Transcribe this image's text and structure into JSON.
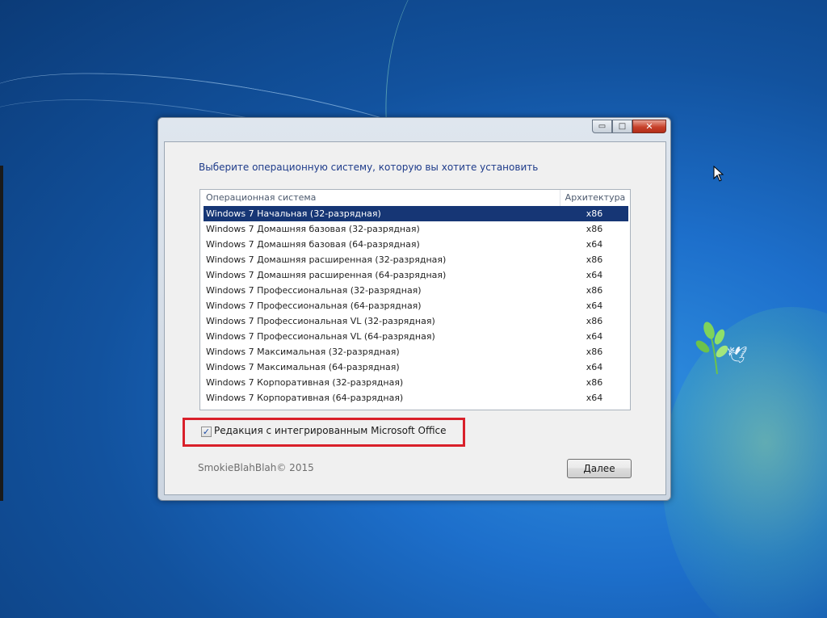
{
  "desktop": {
    "background_color": "#1b63bd",
    "accent_green": "#8ed17a"
  },
  "window": {
    "title_buttons": {
      "minimize_glyph": "▭",
      "maximize_glyph": "□",
      "close_glyph": "✕"
    },
    "prompt": "Выберите операционную систему, которую вы хотите установить",
    "list": {
      "header": {
        "os": "Операционная система",
        "arch": "Архитектура"
      },
      "rows": [
        {
          "os": "Windows 7 Начальная (32-разрядная)",
          "arch": "x86",
          "selected": true
        },
        {
          "os": "Windows 7 Домашняя базовая (32-разрядная)",
          "arch": "x86",
          "selected": false
        },
        {
          "os": "Windows 7 Домашняя базовая (64-разрядная)",
          "arch": "x64",
          "selected": false
        },
        {
          "os": "Windows 7 Домашняя расширенная (32-разрядная)",
          "arch": "x86",
          "selected": false
        },
        {
          "os": "Windows 7 Домашняя расширенная (64-разрядная)",
          "arch": "x64",
          "selected": false
        },
        {
          "os": "Windows 7 Профессиональная (32-разрядная)",
          "arch": "x86",
          "selected": false
        },
        {
          "os": "Windows 7 Профессиональная (64-разрядная)",
          "arch": "x64",
          "selected": false
        },
        {
          "os": "Windows 7 Профессиональная VL (32-разрядная)",
          "arch": "x86",
          "selected": false
        },
        {
          "os": "Windows 7 Профессиональная VL (64-разрядная)",
          "arch": "x64",
          "selected": false
        },
        {
          "os": "Windows 7 Максимальная (32-разрядная)",
          "arch": "x86",
          "selected": false
        },
        {
          "os": "Windows 7 Максимальная (64-разрядная)",
          "arch": "x64",
          "selected": false
        },
        {
          "os": "Windows 7 Корпоративная (32-разрядная)",
          "arch": "x86",
          "selected": false
        },
        {
          "os": "Windows 7 Корпоративная (64-разрядная)",
          "arch": "x64",
          "selected": false
        }
      ],
      "selection_color": "#163675"
    },
    "office_option": {
      "checked": true,
      "check_glyph": "✓",
      "label": "Редакция с интегрированным Microsoft Office",
      "highlight_color": "#d9202a"
    },
    "copyright": "SmokieBlahBlah© 2015",
    "next_button": "Далее"
  },
  "icons": {
    "cursor": "mouse-pointer-icon",
    "dove": "dove-icon",
    "leaves": "green-leaves-icon"
  }
}
